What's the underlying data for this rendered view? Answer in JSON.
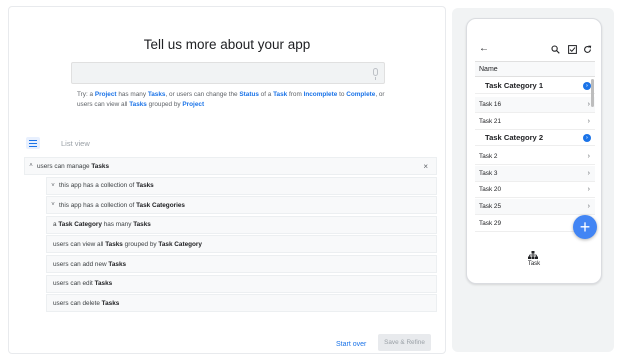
{
  "builder": {
    "title": "Tell us more about your app",
    "prompt_value": "",
    "hint_parts": [
      {
        "t": "Try:  a ",
        "kw": false
      },
      {
        "t": "Project",
        "kw": true
      },
      {
        "t": " has many ",
        "kw": false
      },
      {
        "t": "Tasks",
        "kw": true
      },
      {
        "t": ", or users can change the ",
        "kw": false
      },
      {
        "t": "Status",
        "kw": true
      },
      {
        "t": " of a ",
        "kw": false
      },
      {
        "t": "Task",
        "kw": true
      },
      {
        "t": " from ",
        "kw": false
      },
      {
        "t": "Incomplete",
        "kw": true
      },
      {
        "t": " to ",
        "kw": false
      },
      {
        "t": "Complete",
        "kw": true
      },
      {
        "t": ", or users can view all ",
        "kw": false
      },
      {
        "t": "Tasks",
        "kw": true
      },
      {
        "t": " grouped by ",
        "kw": false
      },
      {
        "t": "Project",
        "kw": true
      }
    ],
    "list_view_label": "List view",
    "tree": [
      {
        "level": 0,
        "chevron": "up",
        "close": true,
        "parts": [
          {
            "t": "users can manage ",
            "b": false
          },
          {
            "t": "Tasks",
            "b": true
          }
        ]
      },
      {
        "level": 1,
        "chevron": "down",
        "parts": [
          {
            "t": "this app has a collection of ",
            "b": false
          },
          {
            "t": "Tasks",
            "b": true
          }
        ]
      },
      {
        "level": 1,
        "chevron": "down",
        "parts": [
          {
            "t": "this app has a collection of ",
            "b": false
          },
          {
            "t": "Task Categories",
            "b": true
          }
        ]
      },
      {
        "level": 1,
        "chevron": "",
        "parts": [
          {
            "t": "a ",
            "b": false
          },
          {
            "t": "Task Category",
            "b": true
          },
          {
            "t": " has many ",
            "b": false
          },
          {
            "t": "Tasks",
            "b": true
          }
        ]
      },
      {
        "level": 1,
        "chevron": "",
        "parts": [
          {
            "t": "users can view all ",
            "b": false
          },
          {
            "t": "Tasks",
            "b": true
          },
          {
            "t": " grouped by ",
            "b": false
          },
          {
            "t": "Task Category",
            "b": true
          }
        ]
      },
      {
        "level": 1,
        "chevron": "",
        "parts": [
          {
            "t": "users can add new ",
            "b": false
          },
          {
            "t": "Tasks",
            "b": true
          }
        ]
      },
      {
        "level": 1,
        "chevron": "",
        "parts": [
          {
            "t": "users can edit ",
            "b": false
          },
          {
            "t": "Tasks",
            "b": true
          }
        ]
      },
      {
        "level": 1,
        "chevron": "",
        "parts": [
          {
            "t": "users can delete ",
            "b": false
          },
          {
            "t": "Tasks",
            "b": true
          }
        ]
      }
    ],
    "start_over_label": "Start over",
    "save_refine_label": "Save & Refine"
  },
  "preview": {
    "icons": [
      "back-arrow-icon",
      "search-icon",
      "checkbox-icon",
      "refresh-icon"
    ],
    "column_header": "Name",
    "rows": [
      {
        "type": "group",
        "label": "Task Category 1"
      },
      {
        "type": "item",
        "label": "Task 16"
      },
      {
        "type": "item",
        "label": "Task 21"
      },
      {
        "type": "group",
        "label": "Task Category 2"
      },
      {
        "type": "item",
        "label": "Task 2"
      },
      {
        "type": "item",
        "label": "Task 3"
      },
      {
        "type": "item",
        "label": "Task 20"
      },
      {
        "type": "item",
        "label": "Task 25"
      },
      {
        "type": "item",
        "label": "Task 29"
      }
    ],
    "fab_label": "+",
    "nav_label": "Task"
  },
  "colors": {
    "accent": "#1a73e8",
    "fab": "#4285f4",
    "panel_bg": "#f1f3f4"
  }
}
